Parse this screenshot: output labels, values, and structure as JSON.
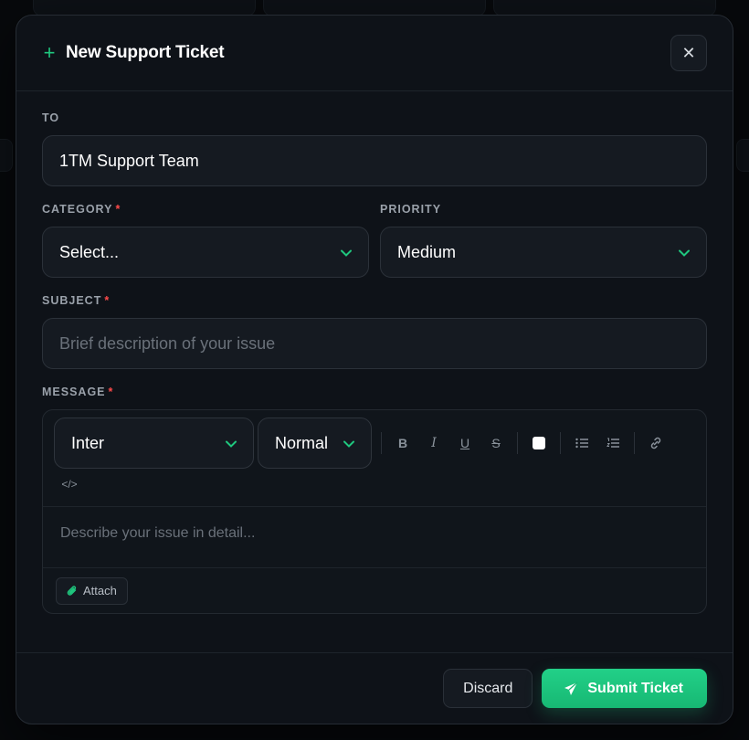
{
  "modal": {
    "title": "New Support Ticket",
    "title_icon": "plus-icon",
    "close_icon": "close-icon"
  },
  "to": {
    "label": "TO",
    "value": "1TM Support Team"
  },
  "category": {
    "label": "CATEGORY",
    "required_mark": "*",
    "value": "Select..."
  },
  "priority": {
    "label": "PRIORITY",
    "value": "Medium"
  },
  "subject": {
    "label": "SUBJECT",
    "required_mark": "*",
    "placeholder": "Brief description of your issue"
  },
  "message": {
    "label": "MESSAGE",
    "required_mark": "*",
    "placeholder": "Describe your issue in detail...",
    "toolbar": {
      "font": "Inter",
      "size": "Normal",
      "bold": "B",
      "italic": "I",
      "underline": "U",
      "strike": "S",
      "code": "</>"
    },
    "attach_label": "Attach"
  },
  "footer": {
    "discard_label": "Discard",
    "submit_label": "Submit Ticket"
  },
  "colors": {
    "accent": "#1fc77e",
    "required": "#ff4a4a",
    "background": "#0e1218"
  }
}
